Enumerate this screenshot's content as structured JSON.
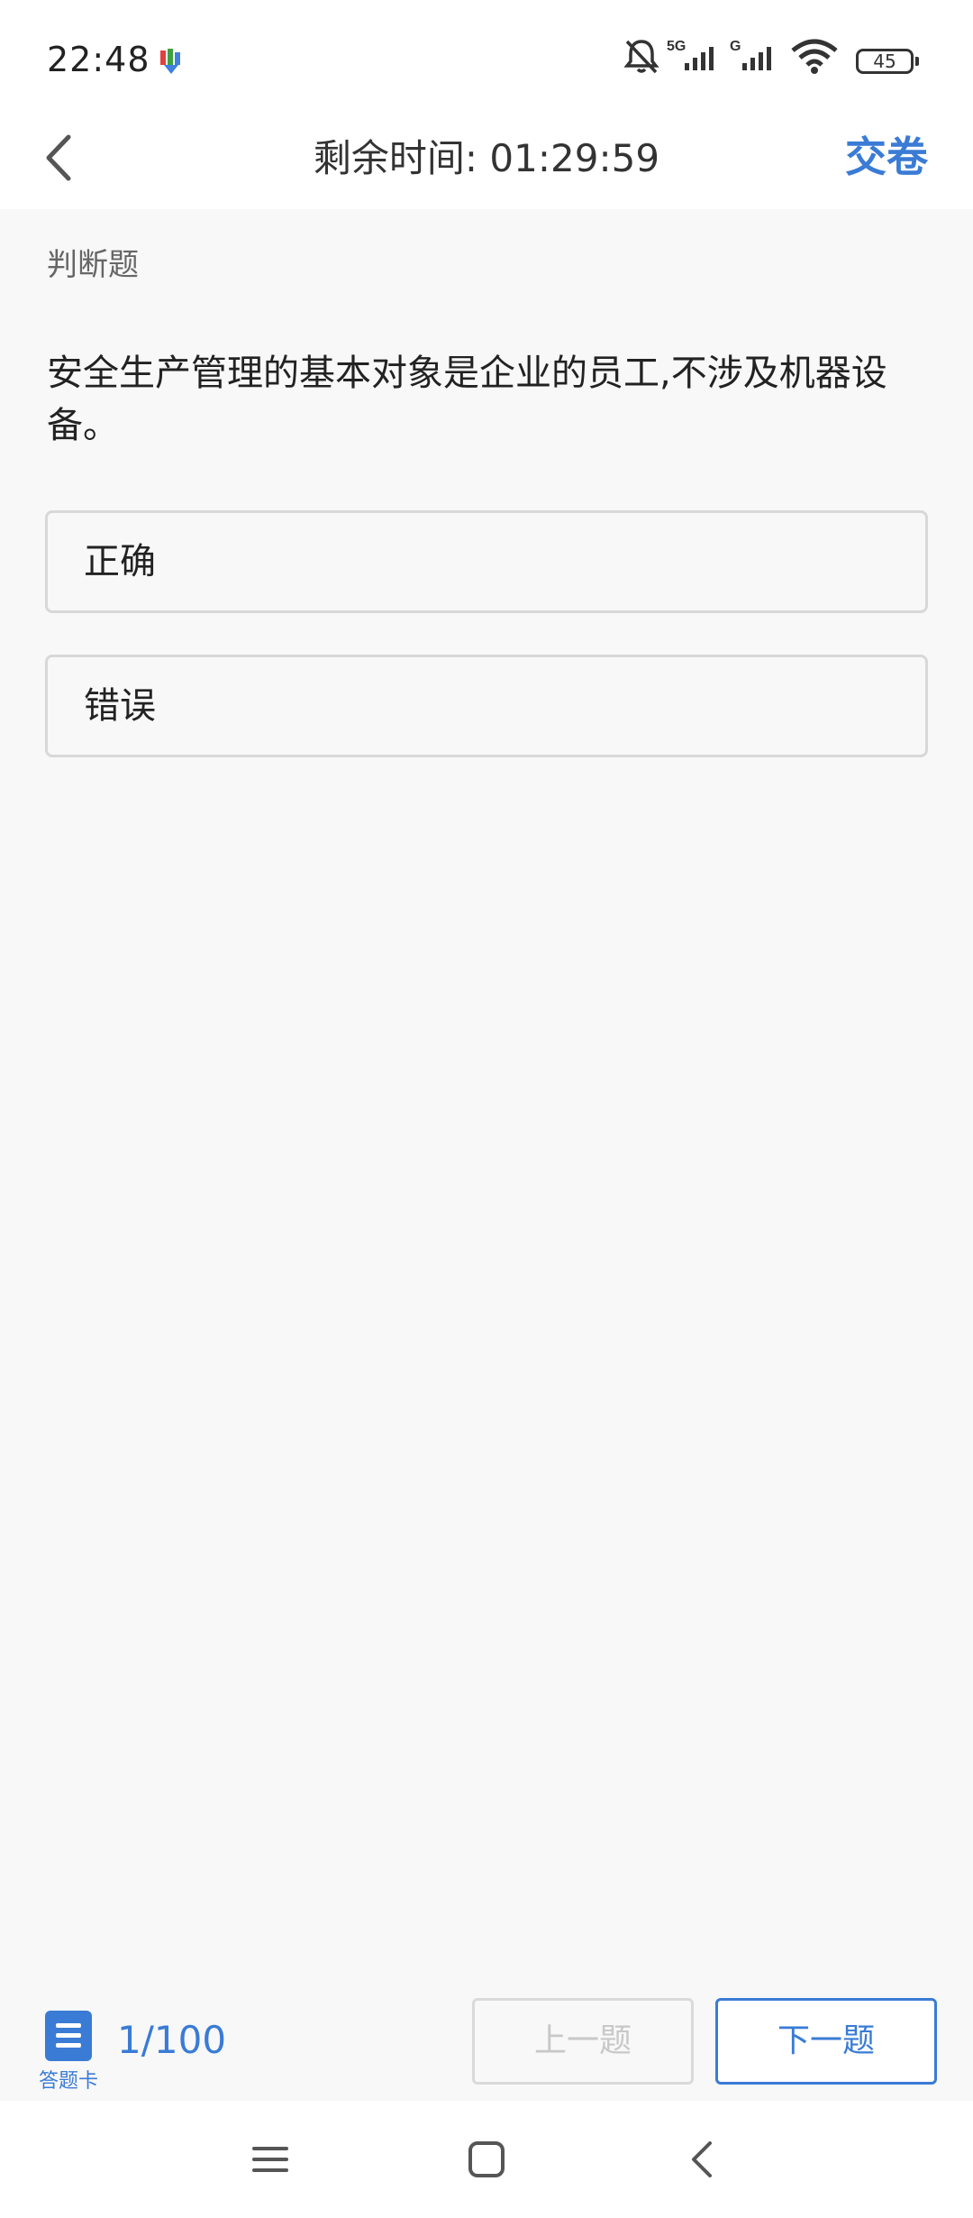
{
  "status_bar": {
    "time": "22:48",
    "battery": "45",
    "icons": [
      "app-download-icon",
      "bell-off-icon",
      "5g-signal-icon",
      "g-signal-icon",
      "wifi-icon",
      "battery-icon"
    ]
  },
  "header": {
    "timer": "剩余时间: 01:29:59",
    "submit_label": "交卷",
    "back_icon": "back-arrow-icon"
  },
  "question": {
    "type": "判断题",
    "text": "安全生产管理的基本对象是企业的员工,不涉及机器设备。",
    "options": [
      {
        "label": "正确"
      },
      {
        "label": "错误"
      }
    ]
  },
  "footer": {
    "answer_card_label": "答题卡",
    "progress": "1/100",
    "prev_label": "上一题",
    "next_label": "下一题"
  },
  "colors": {
    "accent": "#3a7bd5",
    "background": "#f8f8f8",
    "disabled": "#c8c8c8"
  }
}
